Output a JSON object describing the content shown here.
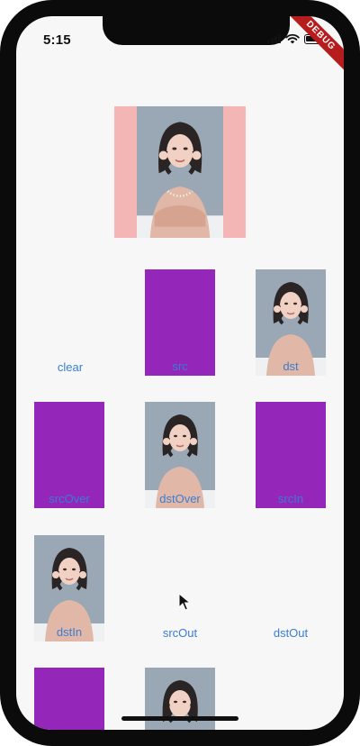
{
  "status": {
    "time": "5:15"
  },
  "banner": {
    "text": "DEBUG"
  },
  "blend_modes": {
    "clear": "clear",
    "src": "src",
    "dst": "dst",
    "srcOver": "srcOver",
    "dstOver": "dstOver",
    "srcIn": "srcIn",
    "dstIn": "dstIn",
    "srcOut": "srcOut",
    "dstOut": "dstOut"
  },
  "colors": {
    "purple": "#9426b9",
    "pink": "#f4b5b5",
    "label_blue": "#3a7dd2"
  },
  "icons": [
    "signal-icon",
    "wifi-icon",
    "battery-icon",
    "cursor-icon"
  ]
}
